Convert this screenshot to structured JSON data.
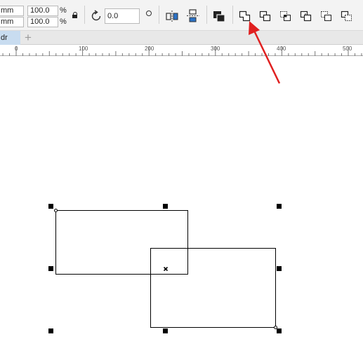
{
  "property_bar": {
    "width_unit": "mm",
    "height_unit": "mm",
    "scale_width": "100.0",
    "scale_height": "100.0",
    "percent_symbol": "%",
    "rotation_angle": "0.0",
    "icons": {
      "lock": "lock-ratio-icon",
      "rotate": "rotate-icon",
      "degree": "degree-icon",
      "mirror_h": "mirror-horizontal-icon",
      "mirror_v": "mirror-vertical-icon",
      "to_front": "bring-to-front-icon",
      "weld": "weld-icon",
      "trim": "trim-icon",
      "intersect": "intersect-icon",
      "simplify": "simplify-icon",
      "front_minus_back": "front-minus-back-icon",
      "back_minus_front": "back-minus-front-icon"
    }
  },
  "document_tab": {
    "label": "dr",
    "add_label": "+"
  },
  "ruler": {
    "labels": [
      "0",
      "100",
      "200",
      "300",
      "400",
      "500"
    ]
  },
  "annotation": {
    "arrow_color": "#e02020",
    "points_to": "weld-icon"
  },
  "canvas": {
    "shape_count": 2,
    "selection_color": "#000000"
  }
}
